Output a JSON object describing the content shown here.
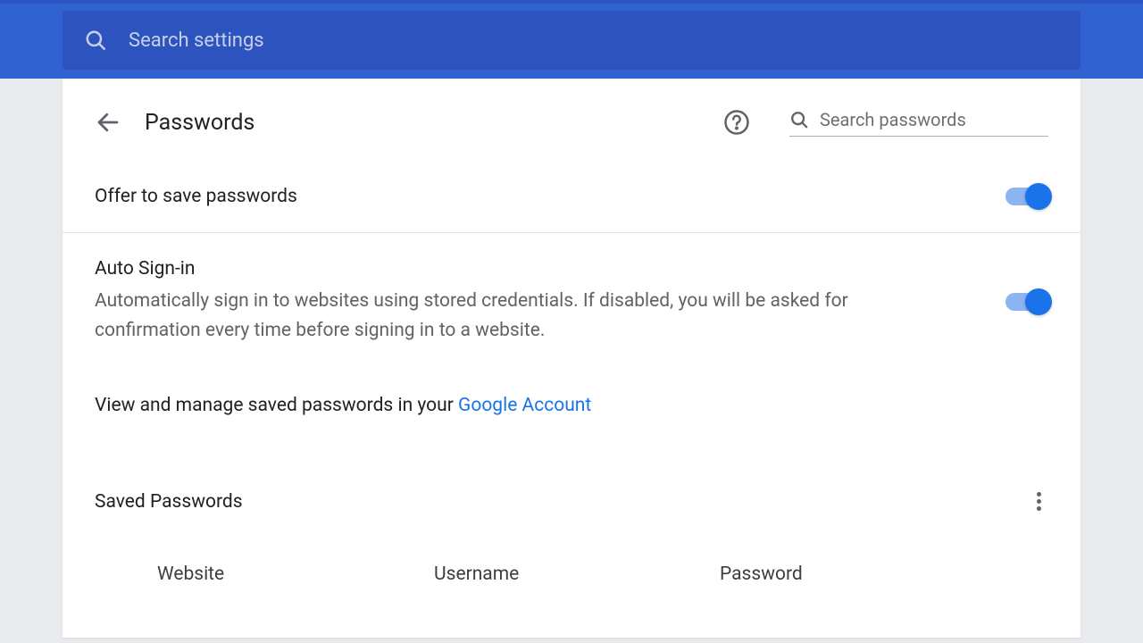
{
  "header": {
    "search_placeholder": "Search settings"
  },
  "page": {
    "title": "Passwords",
    "search_placeholder": "Search passwords"
  },
  "settings": {
    "offer_save": {
      "title": "Offer to save passwords",
      "on": true
    },
    "auto_signin": {
      "title": "Auto Sign-in",
      "desc": "Automatically sign in to websites using stored credentials. If disabled, you will be asked for confirmation every time before signing in to a website.",
      "on": true
    }
  },
  "manage": {
    "prefix": "View and manage saved passwords in your ",
    "link": "Google Account"
  },
  "saved": {
    "title": "Saved Passwords",
    "columns": {
      "website": "Website",
      "username": "Username",
      "password": "Password"
    }
  }
}
